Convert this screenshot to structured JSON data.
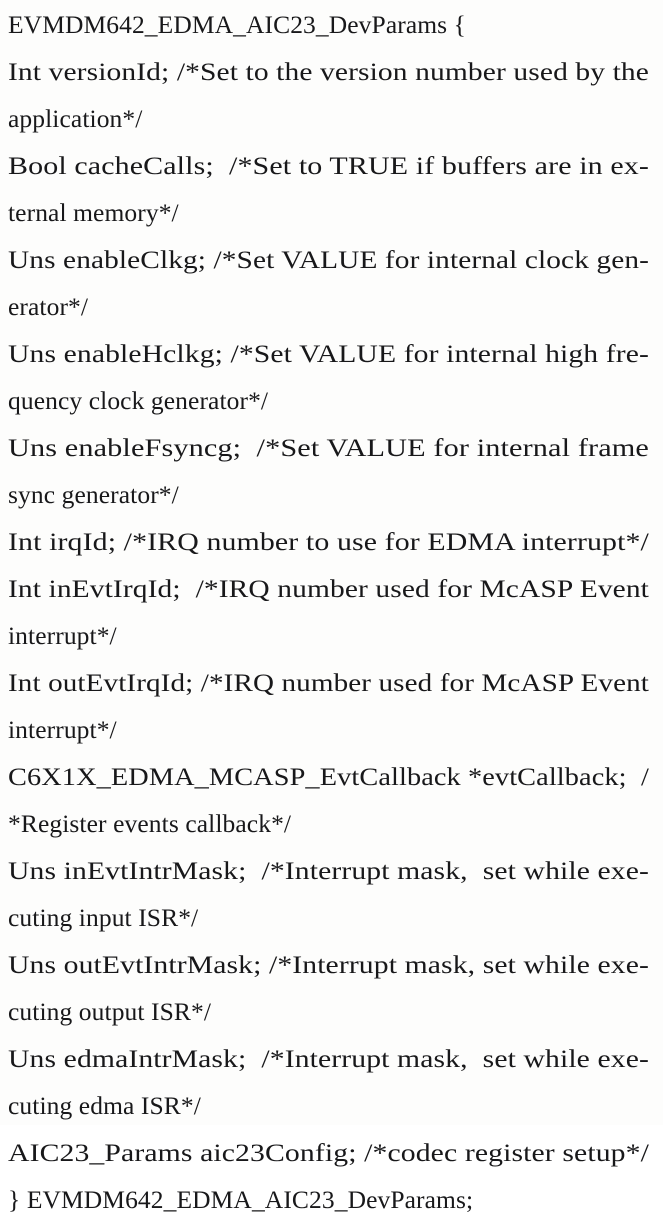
{
  "document": {
    "kind": "scanned-page",
    "background_color": "#fdfdfc",
    "text_color": "#18181a",
    "struct_name": "EVMDM642_EDMA_AIC23_DevParams",
    "lines": [
      {
        "id": "line-1",
        "text": "EVMDM642_EDMA_AIC23_DevParams {"
      },
      {
        "id": "line-2",
        "text": "Int versionId; /*Set to the version number used by the"
      },
      {
        "id": "line-3",
        "text": "application*/"
      },
      {
        "id": "line-4",
        "text": "Bool cacheCalls;  /*Set to TRUE if buffers are in ex-"
      },
      {
        "id": "line-5",
        "text": "ternal memory*/"
      },
      {
        "id": "line-6",
        "text": "Uns enableClkg; /*Set VALUE for internal clock gen-"
      },
      {
        "id": "line-7",
        "text": "erator*/"
      },
      {
        "id": "line-8",
        "text": "Uns enableHclkg; /*Set VALUE for internal high fre-"
      },
      {
        "id": "line-9",
        "text": "quency clock generator*/"
      },
      {
        "id": "line-10",
        "text": "Uns enableFsyncg;  /*Set VALUE for internal frame"
      },
      {
        "id": "line-11",
        "text": "sync generator*/"
      },
      {
        "id": "line-12",
        "text": "Int irqId; /*IRQ number to use for EDMA interrupt*/"
      },
      {
        "id": "line-13",
        "text": "Int inEvtIrqId;  /*IRQ number used for McASP Event"
      },
      {
        "id": "line-14",
        "text": "interrupt*/"
      },
      {
        "id": "line-15",
        "text": "Int outEvtIrqId; /*IRQ number used for McASP Event"
      },
      {
        "id": "line-16",
        "text": "interrupt*/"
      },
      {
        "id": "line-17",
        "text": "C6X1X_EDMA_MCASP_EvtCallback *evtCallback;  /"
      },
      {
        "id": "line-18",
        "text": "*Register events callback*/"
      },
      {
        "id": "line-19",
        "text": "Uns inEvtIntrMask;  /*Interrupt mask,  set while exe-"
      },
      {
        "id": "line-20",
        "text": "cuting input ISR*/"
      },
      {
        "id": "line-21",
        "text": "Uns outEvtIntrMask; /*Interrupt mask, set while exe-"
      },
      {
        "id": "line-22",
        "text": "cuting output ISR*/"
      },
      {
        "id": "line-23",
        "text": "Uns edmaIntrMask;  /*Interrupt mask,  set while exe-"
      },
      {
        "id": "line-24",
        "text": "cuting edma ISR*/"
      },
      {
        "id": "line-25",
        "text": "AIC23_Params aic23Config; /*codec register setup*/"
      },
      {
        "id": "line-26",
        "text": "} EVMDM642_EDMA_AIC23_DevParams;"
      }
    ]
  }
}
